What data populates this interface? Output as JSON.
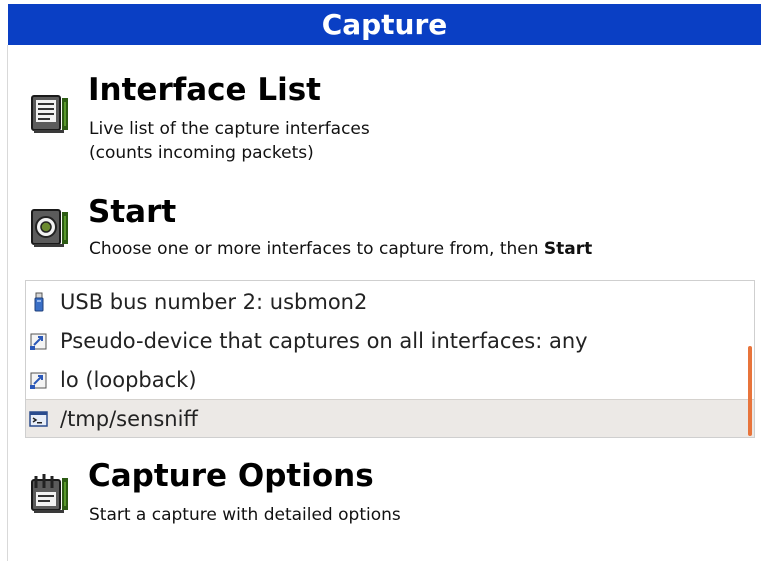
{
  "header": {
    "title": "Capture"
  },
  "sections": {
    "interface_list": {
      "title": "Interface List",
      "desc_line1": "Live list of the capture interfaces",
      "desc_line2": "(counts incoming packets)"
    },
    "start": {
      "title": "Start",
      "desc_prefix": "Choose one or more interfaces to capture from, then ",
      "desc_bold": "Start"
    },
    "capture_options": {
      "title": "Capture Options",
      "desc": "Start a capture with detailed options"
    }
  },
  "interfaces": [
    {
      "label": "USB bus number 2: usbmon2",
      "icon": "usb-stick-icon",
      "selected": false
    },
    {
      "label": "Pseudo-device that captures on all interfaces: any",
      "icon": "network-interface-icon",
      "selected": false
    },
    {
      "label": "lo (loopback)",
      "icon": "network-interface-icon",
      "selected": false
    },
    {
      "label": "/tmp/sensniff",
      "icon": "pipe-terminal-icon",
      "selected": true
    }
  ],
  "colors": {
    "header_bg": "#0a3fc4",
    "selection_bg": "#ece9e6",
    "scrollbar": "#e8743b"
  }
}
